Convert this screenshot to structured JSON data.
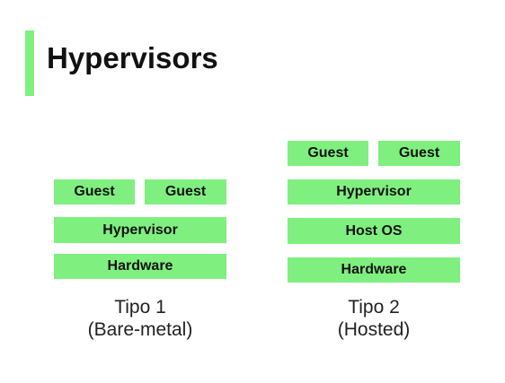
{
  "title": "Hypervisors",
  "colors": {
    "accent": "#7ff07f",
    "box": "#7ff07f",
    "text": "#111111"
  },
  "type1": {
    "guest_left": "Guest",
    "guest_right": "Guest",
    "hypervisor": "Hypervisor",
    "hardware": "Hardware",
    "caption_line1": "Tipo 1",
    "caption_line2": "(Bare-metal)"
  },
  "type2": {
    "guest_left": "Guest",
    "guest_right": "Guest",
    "hypervisor": "Hypervisor",
    "host_os": "Host OS",
    "hardware": "Hardware",
    "caption_line1": "Tipo 2",
    "caption_line2": "(Hosted)"
  }
}
